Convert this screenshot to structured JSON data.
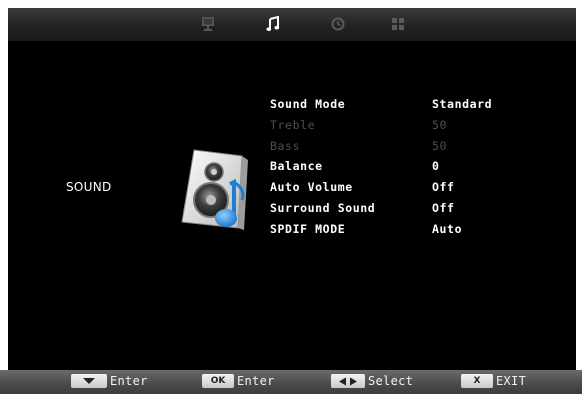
{
  "tabs": [
    {
      "icon": "monitor-icon",
      "active": false
    },
    {
      "icon": "music-note-icon",
      "active": true
    },
    {
      "icon": "clock-icon",
      "active": false
    },
    {
      "icon": "grid-icon",
      "active": false
    }
  ],
  "section": {
    "label": "SOUND",
    "icon": "speaker-music-icon"
  },
  "menu": {
    "items": [
      {
        "label": "Sound Mode",
        "value": "Standard",
        "enabled": true
      },
      {
        "label": "Treble",
        "value": "50",
        "enabled": false
      },
      {
        "label": "Bass",
        "value": "50",
        "enabled": false
      },
      {
        "label": "Balance",
        "value": "0",
        "enabled": true
      },
      {
        "label": "Auto Volume",
        "value": "Off",
        "enabled": true
      },
      {
        "label": "Surround Sound",
        "value": "Off",
        "enabled": true
      },
      {
        "label": "SPDIF MODE",
        "value": "Auto",
        "enabled": true
      }
    ]
  },
  "footer": {
    "hints": [
      {
        "key": "down-arrow-key",
        "key_label": "",
        "text": "Enter"
      },
      {
        "key": "ok-key",
        "key_label": "OK",
        "text": "Enter"
      },
      {
        "key": "left-right-arrow-key",
        "key_label": "",
        "text": "Select"
      },
      {
        "key": "x-key",
        "key_label": "X",
        "text": "EXIT"
      }
    ]
  },
  "colors": {
    "background": "#000000",
    "text": "#ffffff",
    "disabled_text": "#4f4f4f",
    "active_tab": "#ffffff",
    "inactive_tab": "#5a5a5a",
    "accent_blue": "#2a8fe0"
  }
}
